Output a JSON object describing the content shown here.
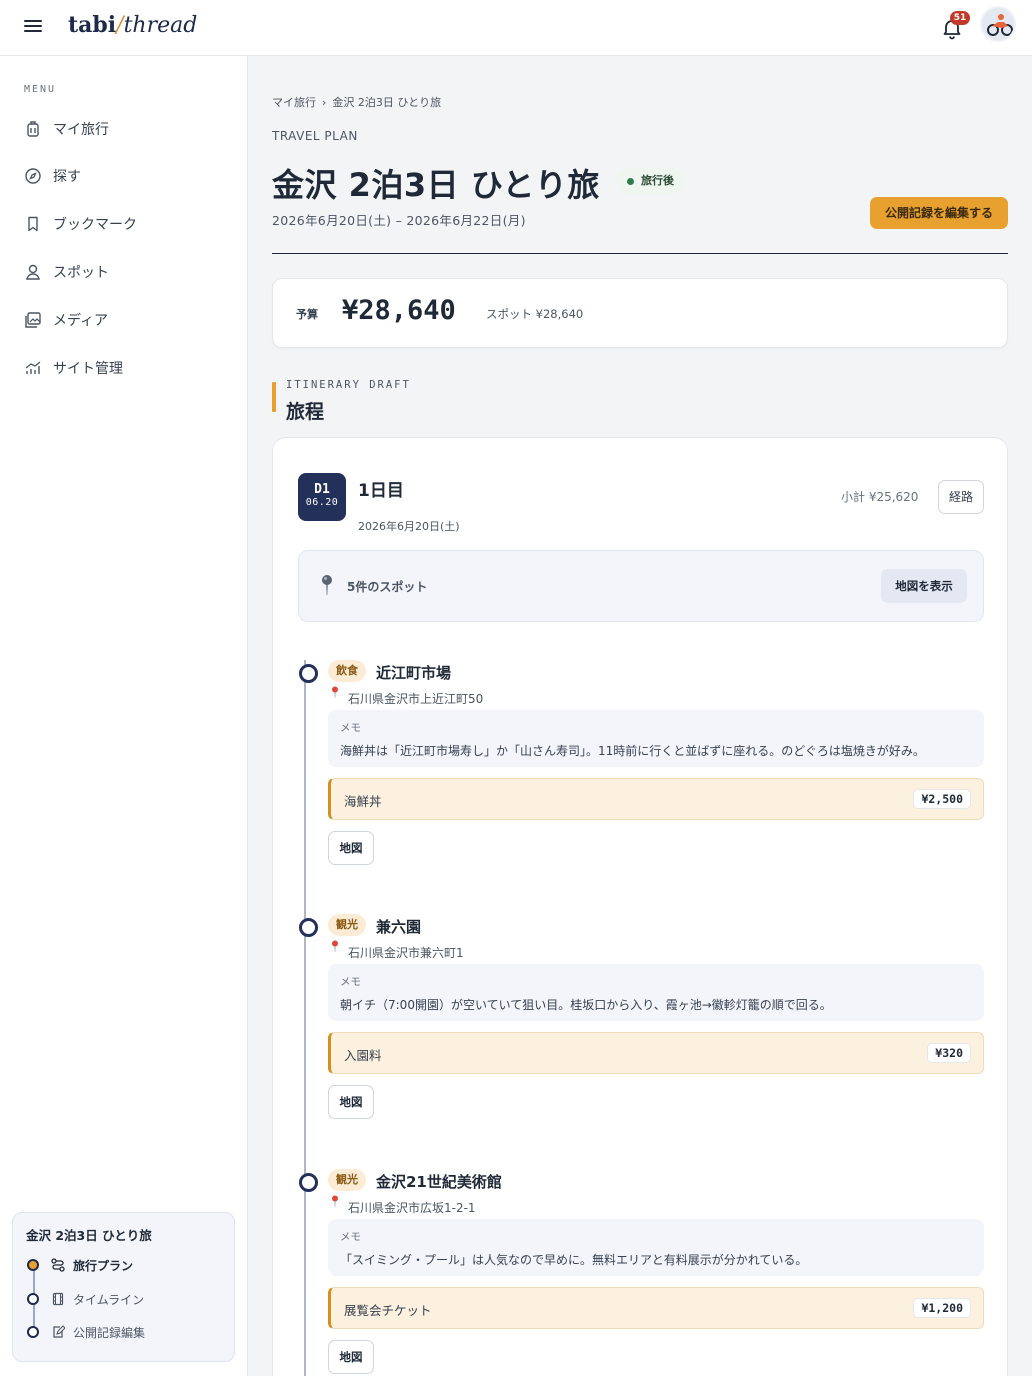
{
  "app": {
    "logo_main": "tabi",
    "logo_slash": "/",
    "logo_sub": "thread",
    "notification_count": "51"
  },
  "sidebar": {
    "menu_label": "MENU",
    "items": [
      {
        "label": "マイ旅行",
        "icon": "suitcase-icon"
      },
      {
        "label": "探す",
        "icon": "compass-icon"
      },
      {
        "label": "ブックマーク",
        "icon": "bookmark-icon"
      },
      {
        "label": "スポット",
        "icon": "location-user-icon"
      },
      {
        "label": "メディア",
        "icon": "media-icon"
      },
      {
        "label": "サイト管理",
        "icon": "analytics-icon"
      }
    ],
    "plan_card": {
      "title": "金沢 2泊3日 ひとり旅",
      "items": [
        {
          "label": "旅行プラン",
          "active": true,
          "icon": "route-icon"
        },
        {
          "label": "タイムライン",
          "active": false,
          "icon": "film-icon"
        },
        {
          "label": "公開記録編集",
          "active": false,
          "icon": "edit-doc-icon"
        }
      ]
    }
  },
  "main": {
    "breadcrumb": [
      "マイ旅行",
      "›",
      "金沢 2泊3日 ひとり旅"
    ],
    "eyebrow": "TRAVEL PLAN",
    "title": "金沢 2泊3日 ひとり旅",
    "status": "旅行後",
    "date_range": "2026年6月20日(土) – 2026年6月22日(月)",
    "edit_button": "公開記録を編集する",
    "budget": {
      "label": "予算",
      "amount": "¥28,640",
      "breakdown": "スポット ¥28,640"
    },
    "section": {
      "eyebrow": "ITINERARY DRAFT",
      "title": "旅程"
    },
    "day": {
      "badge_day": "D1",
      "badge_date": "06.20",
      "title": "1日目",
      "date": "2026年6月20日(土)",
      "subtotal": "小計 ¥25,620",
      "route_button": "経路",
      "spots_count": "5件のスポット",
      "map_button": "地図を表示",
      "stops": [
        {
          "category": "飲食",
          "name": "近江町市場",
          "address": "石川県金沢市上近江町50",
          "memo_label": "メモ",
          "memo": "海鮮丼は「近江町市場寿し」か「山さん寿司」。11時前に行くと並ばずに座れる。のどぐろは塩焼きが好み。",
          "expense_name": "海鮮丼",
          "expense_amount": "¥2,500",
          "map_button": "地図"
        },
        {
          "category": "観光",
          "name": "兼六園",
          "address": "石川県金沢市兼六町1",
          "memo_label": "メモ",
          "memo": "朝イチ（7:00開園）が空いていて狙い目。桂坂口から入り、霞ヶ池→徽軫灯籠の順で回る。",
          "expense_name": "入園料",
          "expense_amount": "¥320",
          "map_button": "地図"
        },
        {
          "category": "観光",
          "name": "金沢21世紀美術館",
          "address": "石川県金沢市広坂1-2-1",
          "memo_label": "メモ",
          "memo": "「スイミング・プール」は人気なので早めに。無料エリアと有料展示が分かれている。",
          "expense_name": "展覧会チケット",
          "expense_amount": "¥1,200",
          "map_button": "地図"
        }
      ]
    }
  }
}
